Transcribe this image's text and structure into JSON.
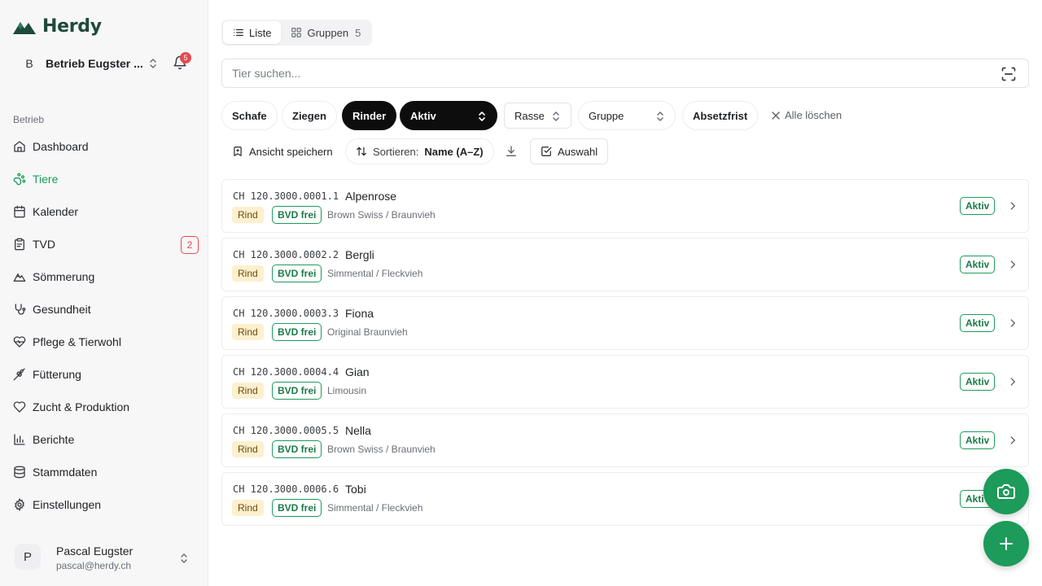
{
  "app": {
    "name": "Herdy"
  },
  "farm": {
    "avatar": "B",
    "name": "Betrieb Eugster ...",
    "notifications": "5"
  },
  "sidebar": {
    "section_label": "Betrieb",
    "items": [
      {
        "label": "Dashboard",
        "icon": "home-icon"
      },
      {
        "label": "Tiere",
        "icon": "paw-icon",
        "active": true
      },
      {
        "label": "Kalender",
        "icon": "calendar-icon"
      },
      {
        "label": "TVD",
        "icon": "clipboard-icon",
        "count": "2"
      },
      {
        "label": "Sömmerung",
        "icon": "mountain-icon"
      },
      {
        "label": "Gesundheit",
        "icon": "stethoscope-icon"
      },
      {
        "label": "Pflege & Tierwohl",
        "icon": "heart-pulse-icon"
      },
      {
        "label": "Fütterung",
        "icon": "wheat-icon"
      },
      {
        "label": "Zucht & Produktion",
        "icon": "heart-icon"
      },
      {
        "label": "Berichte",
        "icon": "bar-chart-icon"
      },
      {
        "label": "Stammdaten",
        "icon": "database-icon"
      },
      {
        "label": "Einstellungen",
        "icon": "gear-icon"
      }
    ]
  },
  "user": {
    "avatar": "P",
    "name": "Pascal Eugster",
    "email": "pascal@herdy.ch"
  },
  "view": {
    "list_label": "Liste",
    "groups_label": "Gruppen",
    "groups_count": "5"
  },
  "search": {
    "placeholder": "Tier suchen..."
  },
  "filters": {
    "schafe": "Schafe",
    "ziegen": "Ziegen",
    "rinder": "Rinder",
    "status": "Aktiv",
    "rasse": "Rasse",
    "gruppe": "Gruppe",
    "absetzfrist": "Absetzfrist",
    "clear": "Alle löschen"
  },
  "toolbar": {
    "save_view": "Ansicht speichern",
    "sort_label": "Sortieren:",
    "sort_value": "Name (A–Z)",
    "select": "Auswahl"
  },
  "animals": [
    {
      "id": "CH 120.3000.0001.1",
      "name": "Alpenrose",
      "species": "Rind",
      "bvd": "BVD frei",
      "breed": "Brown Swiss / Braunvieh",
      "status": "Aktiv"
    },
    {
      "id": "CH 120.3000.0002.2",
      "name": "Bergli",
      "species": "Rind",
      "bvd": "BVD frei",
      "breed": "Simmental / Fleckvieh",
      "status": "Aktiv"
    },
    {
      "id": "CH 120.3000.0003.3",
      "name": "Fiona",
      "species": "Rind",
      "bvd": "BVD frei",
      "breed": "Original Braunvieh",
      "status": "Aktiv"
    },
    {
      "id": "CH 120.3000.0004.4",
      "name": "Gian",
      "species": "Rind",
      "bvd": "BVD frei",
      "breed": "Limousin",
      "status": "Aktiv"
    },
    {
      "id": "CH 120.3000.0005.5",
      "name": "Nella",
      "species": "Rind",
      "bvd": "BVD frei",
      "breed": "Brown Swiss / Braunvieh",
      "status": "Aktiv"
    },
    {
      "id": "CH 120.3000.0006.6",
      "name": "Tobi",
      "species": "Rind",
      "bvd": "BVD frei",
      "breed": "Simmental / Fleckvieh",
      "status": "Aktiv"
    }
  ],
  "colors": {
    "brand": "#1f4a3b",
    "accent": "#1d9b5a",
    "danger": "#e5484d",
    "rind_badge": "#fdf0cf"
  }
}
